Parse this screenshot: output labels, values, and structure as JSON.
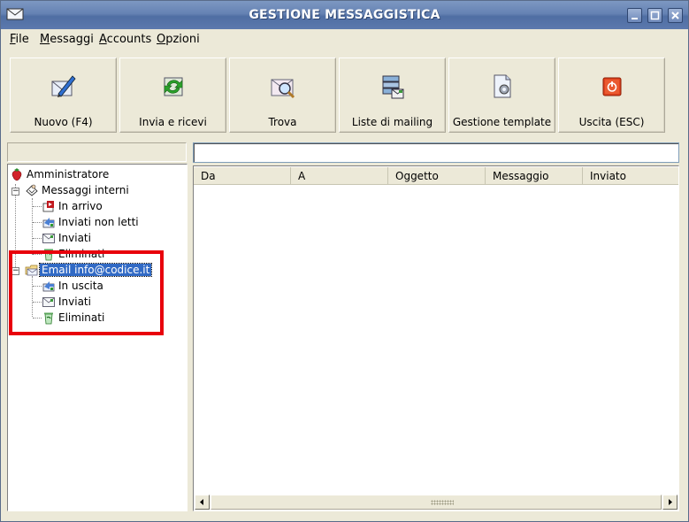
{
  "window": {
    "title": "GESTIONE MESSAGGISTICA"
  },
  "menu": [
    {
      "label": "File",
      "mnemonic": "F",
      "rest": "ile"
    },
    {
      "label": "Messaggi",
      "mnemonic": "M",
      "rest": "essaggi"
    },
    {
      "label": "Accounts",
      "mnemonic": "A",
      "rest": "ccounts"
    },
    {
      "label": "Opzioni",
      "mnemonic": "O",
      "rest": "pzioni"
    }
  ],
  "toolbar": [
    {
      "label": "Nuovo (F4)",
      "icon": "pen-envelope-icon"
    },
    {
      "label": "Invia e ricevi",
      "icon": "send-receive-icon"
    },
    {
      "label": "Trova",
      "icon": "find-envelope-icon"
    },
    {
      "label": "Liste di mailing",
      "icon": "mailing-list-icon"
    },
    {
      "label": "Gestione template",
      "icon": "template-gear-icon"
    },
    {
      "label": "Uscita (ESC)",
      "icon": "exit-icon"
    }
  ],
  "search": {
    "value": ""
  },
  "tree": {
    "root": "Amministratore",
    "internal": {
      "label": "Messaggi interni",
      "children": [
        "In arrivo",
        "Inviati non letti",
        "Inviati",
        "Eliminati"
      ]
    },
    "email": {
      "label": "Email info@codice.it",
      "children": [
        "In uscita",
        "Inviati",
        "Eliminati"
      ]
    }
  },
  "columns": [
    "Da",
    "A",
    "Oggetto",
    "Messaggio",
    "Inviato"
  ],
  "colors": {
    "titlebar": "#6582b3",
    "selection": "#316ac5",
    "highlight_box": "#e8000c"
  }
}
